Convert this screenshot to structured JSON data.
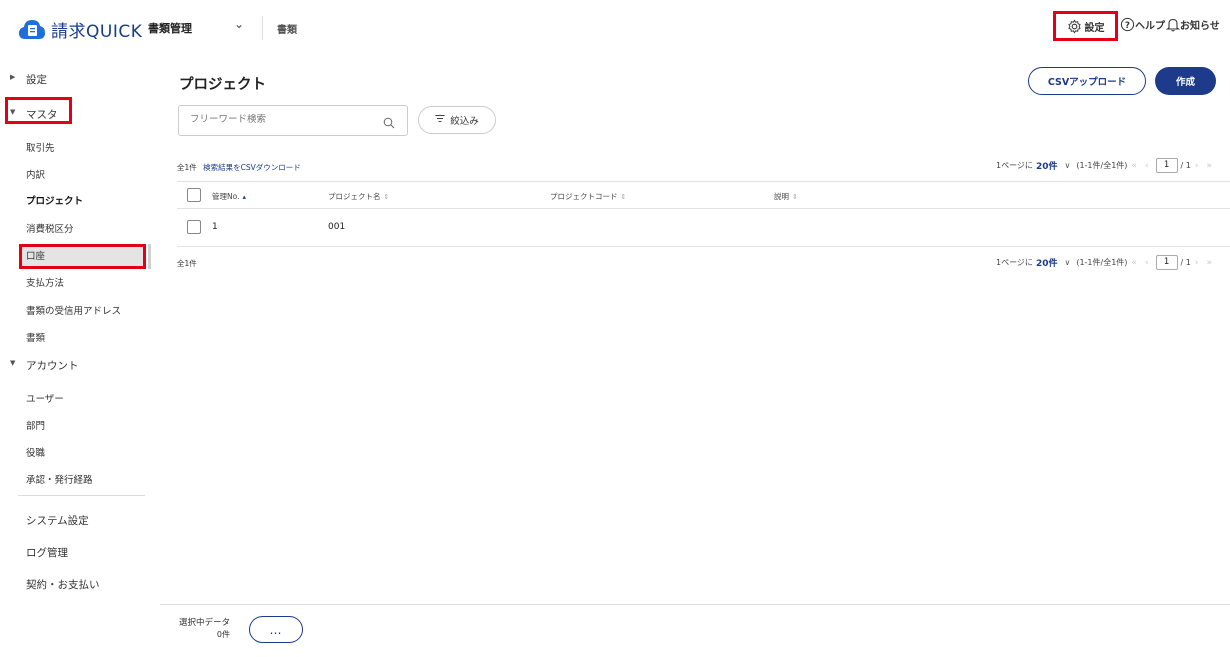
{
  "header": {
    "logo_text": "請求QUICK",
    "product_select": "書類管理",
    "breadcrumb": "書類",
    "settings_label": "設定",
    "help_label": "ヘルプ",
    "notice_label": "お知らせ"
  },
  "sidebar": {
    "groups": [
      {
        "label": "設定"
      },
      {
        "label": "マスタ"
      },
      {
        "label": "アカウント"
      }
    ],
    "master_items": [
      "取引先",
      "内訳",
      "プロジェクト",
      "消費税区分",
      "口座",
      "支払方法",
      "書類の受信用アドレス",
      "書類"
    ],
    "account_items": [
      "ユーザー",
      "部門",
      "役職",
      "承認・発行経路"
    ],
    "bottom_items": [
      "システム設定",
      "ログ管理",
      "契約・お支払い"
    ],
    "active_item": "プロジェクト"
  },
  "main": {
    "title": "プロジェクト",
    "csv_upload_label": "CSVアップロード",
    "create_label": "作成",
    "search_placeholder": "フリーワード検索",
    "filter_label": "絞込み",
    "total_label": "全1件",
    "csv_download_link": "検索結果をCSVダウンロード",
    "pager": {
      "per_page_prefix": "1ページに",
      "per_page_value": "20件",
      "range": "(1-1件/全1件)",
      "current_page": "1",
      "total_pages": "/ 1"
    },
    "table": {
      "columns": [
        "管理No.",
        "プロジェクト名",
        "プロジェクトコード",
        "説明"
      ],
      "rows": [
        {
          "no": "1",
          "name": "001",
          "code": "",
          "description": ""
        }
      ]
    },
    "total_bottom": "全1件"
  },
  "footer": {
    "selected_label": "選択中データ",
    "selected_count": "0件",
    "more_label": "…"
  },
  "colors": {
    "brand": "#1e3a8a",
    "highlight": "#e30016",
    "logo_blue": "#1f6fd8"
  },
  "icons": {
    "logo": "document-logo-icon",
    "settings": "gear-icon",
    "help": "question-circle-icon",
    "notice": "bell-icon",
    "search": "search-icon",
    "filter": "filter-icon"
  }
}
